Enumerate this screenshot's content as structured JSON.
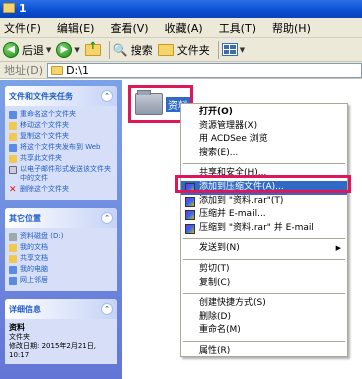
{
  "window": {
    "title": "1"
  },
  "menubar": [
    "文件(F)",
    "编辑(E)",
    "查看(V)",
    "收藏(A)",
    "工具(T)",
    "帮助(H)"
  ],
  "toolbar": {
    "back_label": "后退",
    "search_label": "搜索",
    "folders_label": "文件夹"
  },
  "address": {
    "label": "地址(D)",
    "value": "D:\\1"
  },
  "taskpane": {
    "file_tasks": {
      "title": "文件和文件夹任务",
      "items": [
        "重命名这个文件夹",
        "移动这个文件夹",
        "复制这个文件夹",
        "将这个文件夹发布到 Web",
        "共享此文件夹",
        "以电子邮件形式发送该文件夹中的文件",
        "删除这个文件夹"
      ]
    },
    "other_places": {
      "title": "其它位置",
      "items": [
        "资料磁盘 (D:)",
        "我的文档",
        "共享文档",
        "我的电脑",
        "网上邻居"
      ]
    },
    "details": {
      "title": "详细信息",
      "name": "资料",
      "type": "文件夹",
      "modified": "修改日期: 2015年2月21日, 10:17"
    }
  },
  "folder": {
    "name": "资料"
  },
  "context_menu": {
    "items": [
      {
        "label": "打开(O)",
        "bold": true
      },
      {
        "label": "资源管理器(X)"
      },
      {
        "label": "用 ACDSee 浏览"
      },
      {
        "label": "搜索(E)..."
      },
      {
        "sep": true
      },
      {
        "label": "共享和安全(H)..."
      },
      {
        "label": "添加到压缩文件(A)...",
        "icon": true,
        "highlighted": true
      },
      {
        "label": "添加到 \"资料.rar\"(T)",
        "icon": true
      },
      {
        "label": "压缩并 E-mail...",
        "icon": true
      },
      {
        "label": "压缩到 \"资料.rar\" 并 E-mail",
        "icon": true
      },
      {
        "sep": true
      },
      {
        "label": "发送到(N)",
        "submenu": true
      },
      {
        "sep": true
      },
      {
        "label": "剪切(T)"
      },
      {
        "label": "复制(C)"
      },
      {
        "sep": true
      },
      {
        "label": "创建快捷方式(S)"
      },
      {
        "label": "删除(D)"
      },
      {
        "label": "重命名(M)"
      },
      {
        "sep": true
      },
      {
        "label": "属性(R)"
      }
    ]
  },
  "colors": {
    "highlight": "#316ac5",
    "annotation": "#e0165a"
  }
}
